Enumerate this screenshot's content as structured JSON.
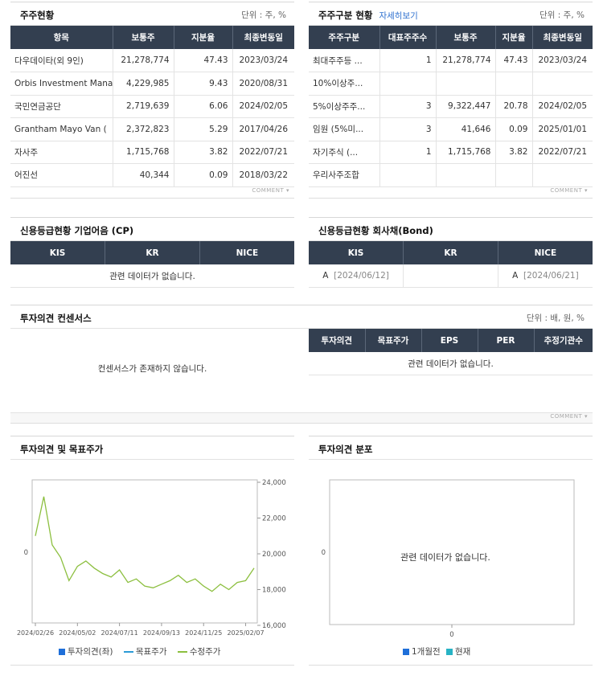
{
  "shareholders": {
    "title": "주주현황",
    "unit": "단위 : 주, %",
    "headers": [
      "항목",
      "보통주",
      "지분율",
      "최종변동일"
    ],
    "rows": [
      {
        "name": "다우데이타(외 9인)",
        "shares": "21,278,774",
        "ratio": "47.43",
        "date": "2023/03/24"
      },
      {
        "name": "Orbis Investment Mana",
        "shares": "4,229,985",
        "ratio": "9.43",
        "date": "2020/08/31"
      },
      {
        "name": "국민연금공단",
        "shares": "2,719,639",
        "ratio": "6.06",
        "date": "2024/02/05"
      },
      {
        "name": "Grantham Mayo Van (",
        "shares": "2,372,823",
        "ratio": "5.29",
        "date": "2017/04/26"
      },
      {
        "name": "자사주",
        "shares": "1,715,768",
        "ratio": "3.82",
        "date": "2022/07/21"
      },
      {
        "name": "어진선",
        "shares": "40,344",
        "ratio": "0.09",
        "date": "2018/03/22"
      }
    ],
    "comment": "COMMENT"
  },
  "holder_types": {
    "title": "주주구분 현황",
    "link": "자세히보기",
    "unit": "단위 : 주, %",
    "headers": [
      "주주구분",
      "대표주주수",
      "보통주",
      "지분율",
      "최종변동일"
    ],
    "rows": [
      {
        "type": "최대주주등 ...",
        "count": "1",
        "shares": "21,278,774",
        "ratio": "47.43",
        "date": "2023/03/24"
      },
      {
        "type": "10%이상주...",
        "count": "",
        "shares": "",
        "ratio": "",
        "date": ""
      },
      {
        "type": "5%이상주주...",
        "count": "3",
        "shares": "9,322,447",
        "ratio": "20.78",
        "date": "2024/02/05"
      },
      {
        "type": "임원 (5%미...",
        "count": "3",
        "shares": "41,646",
        "ratio": "0.09",
        "date": "2025/01/01"
      },
      {
        "type": "자기주식 (...",
        "count": "1",
        "shares": "1,715,768",
        "ratio": "3.82",
        "date": "2022/07/21"
      },
      {
        "type": "우리사주조합",
        "count": "",
        "shares": "",
        "ratio": "",
        "date": ""
      }
    ],
    "comment": "COMMENT"
  },
  "credit_cp": {
    "title": "신용등급현황 기업어음 (CP)",
    "headers": [
      "KIS",
      "KR",
      "NICE"
    ],
    "nodata": "관련 데이터가 없습니다."
  },
  "credit_bond": {
    "title": "신용등급현황 회사채(Bond)",
    "headers": [
      "KIS",
      "KR",
      "NICE"
    ],
    "kis_grade": "A",
    "kis_date": "[2024/06/12]",
    "kr": "",
    "nice_grade": "A",
    "nice_date": "[2024/06/21]"
  },
  "consensus": {
    "title": "투자의견 컨센서스",
    "unit": "단위 : 배, 원, %",
    "nodata_left": "컨센서스가 존재하지 않습니다.",
    "headers": [
      "투자의견",
      "목표주가",
      "EPS",
      "PER",
      "추정기관수"
    ],
    "nodata_right": "관련 데이터가 없습니다.",
    "comment": "COMMENT"
  },
  "price_chart": {
    "title": "투자의견 및 목표주가",
    "legend": [
      "투자의견(좌)",
      "목표주가",
      "수정주가"
    ],
    "colors": {
      "opinion": "#1e6fd9",
      "target": "#2b9bd6",
      "price": "#8cbf3f"
    }
  },
  "dist_chart": {
    "title": "투자의견 분포",
    "nodata": "관련 데이터가 없습니다.",
    "legend": [
      "1개월전",
      "현재"
    ],
    "colors": {
      "prev": "#1e6fd9",
      "now": "#27b3c5"
    }
  },
  "chart_data": [
    {
      "type": "line",
      "title": "투자의견 및 목표주가",
      "x": [
        "2024/02/26",
        "2024/03/10",
        "2024/03/24",
        "2024/04/07",
        "2024/04/21",
        "2024/05/02",
        "2024/05/16",
        "2024/05/30",
        "2024/06/13",
        "2024/06/27",
        "2024/07/11",
        "2024/07/25",
        "2024/08/08",
        "2024/08/22",
        "2024/09/05",
        "2024/09/13",
        "2024/09/27",
        "2024/10/11",
        "2024/10/25",
        "2024/11/08",
        "2024/11/25",
        "2024/12/09",
        "2024/12/23",
        "2025/01/06",
        "2025/01/20",
        "2025/02/07",
        "2025/02/14"
      ],
      "xticks": [
        "2024/02/26",
        "2024/05/02",
        "2024/07/11",
        "2024/09/13",
        "2024/11/25",
        "2025/02/07"
      ],
      "series": [
        {
          "name": "수정주가",
          "values": [
            21000,
            23200,
            20500,
            19800,
            18500,
            19300,
            19600,
            19200,
            18900,
            18700,
            19100,
            18400,
            18600,
            18200,
            18100,
            18300,
            18500,
            18800,
            18400,
            18600,
            18200,
            17900,
            18300,
            18000,
            18400,
            18500,
            19200
          ]
        }
      ],
      "y_right_ticks": [
        16000,
        18000,
        20000,
        22000,
        24000
      ],
      "ylim_right": [
        16000,
        24000
      ],
      "y_left_ticks": [
        0
      ]
    },
    {
      "type": "bar",
      "title": "투자의견 분포",
      "categories": [],
      "series": [
        {
          "name": "1개월전",
          "values": []
        },
        {
          "name": "현재",
          "values": []
        }
      ],
      "x_ticks": [
        0
      ],
      "y_ticks": [
        0
      ]
    }
  ]
}
